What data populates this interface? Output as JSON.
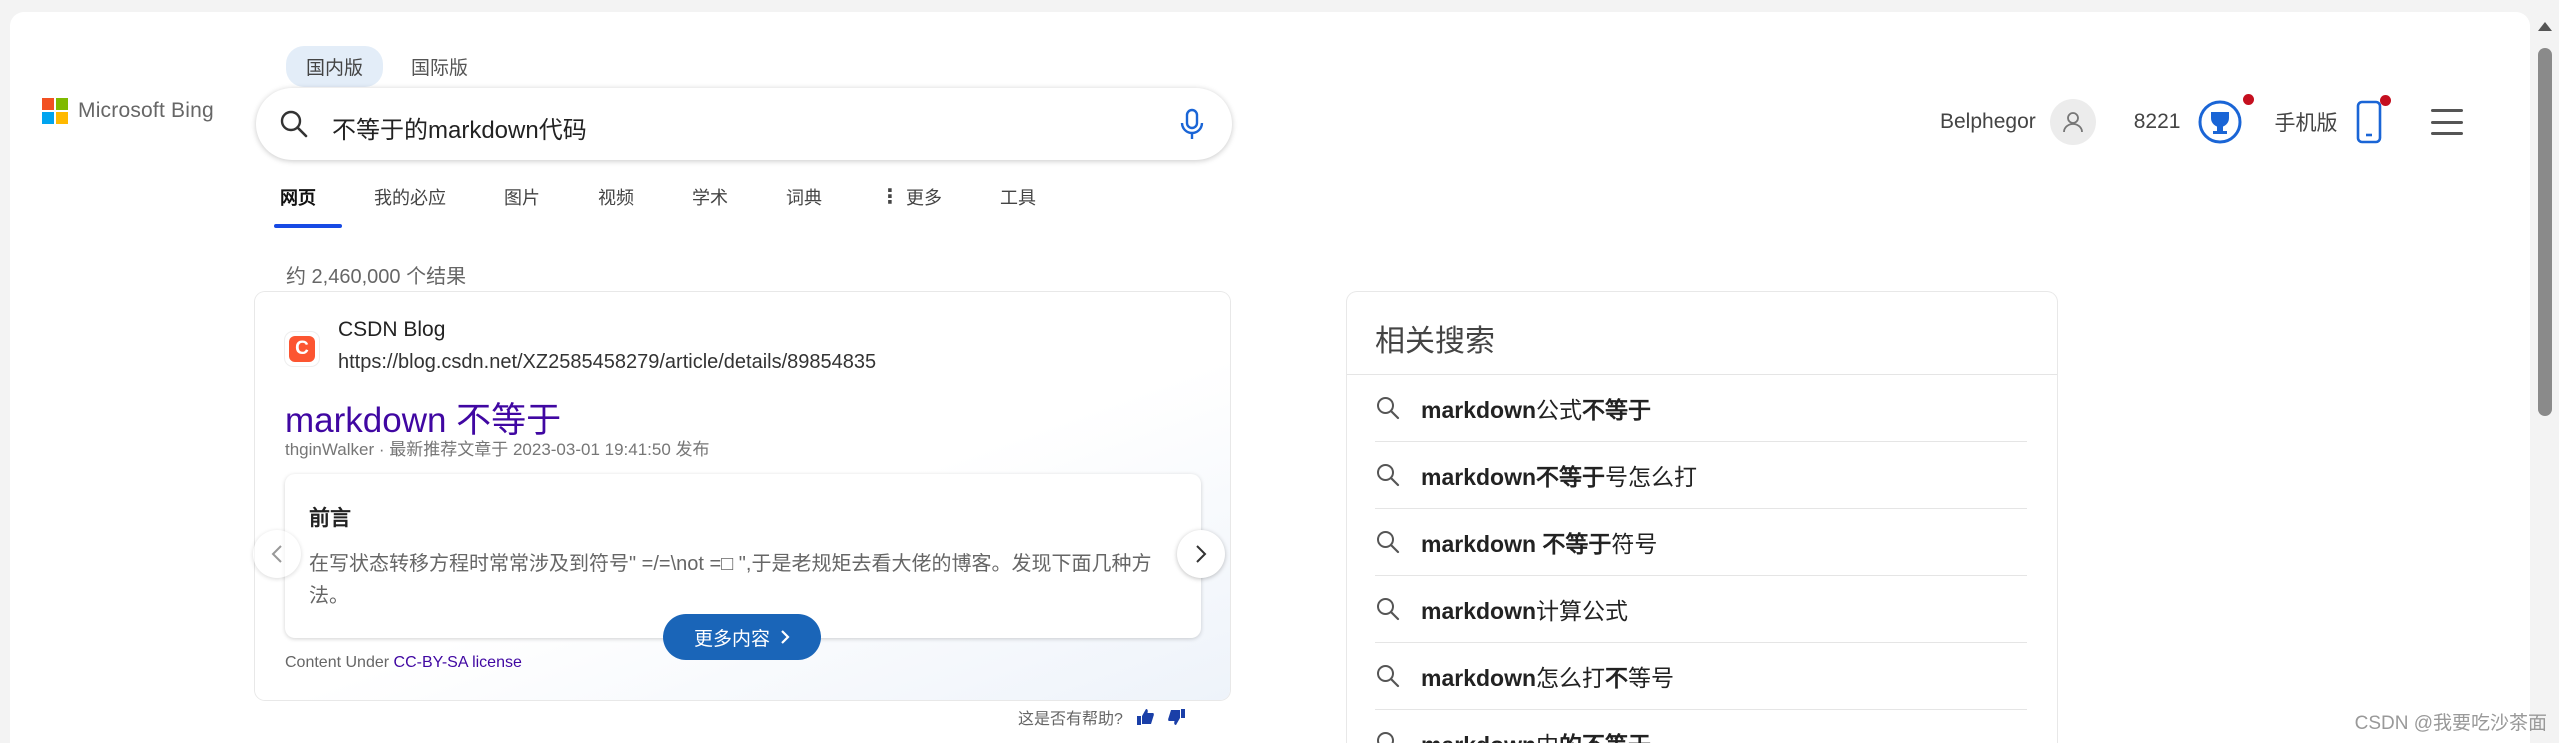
{
  "brand": {
    "logo_text": "Microsoft Bing"
  },
  "region_tabs": [
    {
      "label": "国内版",
      "active": true
    },
    {
      "label": "国际版",
      "active": false
    }
  ],
  "search": {
    "query": "不等于的markdown代码"
  },
  "nav_tabs": [
    {
      "label": "网页",
      "active": true
    },
    {
      "label": "我的必应"
    },
    {
      "label": "图片"
    },
    {
      "label": "视频"
    },
    {
      "label": "学术"
    },
    {
      "label": "词典"
    },
    {
      "label": "更多"
    },
    {
      "label": "工具"
    }
  ],
  "user": {
    "name": "Belphegor",
    "points": "8221",
    "mobile_label": "手机版"
  },
  "result_count": "约 2,460,000 个结果",
  "result": {
    "site_icon_letter": "C",
    "site_name": "CSDN Blog",
    "url": "https://blog.csdn.net/XZ2585458279/article/details/89854835",
    "title": "markdown 不等于",
    "meta": "thginWalker · 最新推荐文章于 2023-03-01 19:41:50 发布",
    "card_heading": "前言",
    "card_body": "在写状态转移方程时常常涉及到符号\" =/=\\not =□ \",于是老规矩去看大佬的博客。发现下面几种方法。",
    "more_button": "更多内容",
    "license_prefix": "Content Under ",
    "license_link": "CC-BY-SA license"
  },
  "feedback": {
    "label": "这是否有帮助?"
  },
  "related": {
    "title": "相关搜索",
    "items": [
      [
        {
          "t": "markdown",
          "b": true
        },
        {
          "t": "公式",
          "b": false
        },
        {
          "t": "不等于",
          "b": true
        }
      ],
      [
        {
          "t": "markdown不等于",
          "b": true
        },
        {
          "t": "号怎么打",
          "b": false
        }
      ],
      [
        {
          "t": "markdown 不等于",
          "b": true
        },
        {
          "t": "符号",
          "b": false
        }
      ],
      [
        {
          "t": "markdown",
          "b": true
        },
        {
          "t": "计算公式",
          "b": false
        }
      ],
      [
        {
          "t": "markdown",
          "b": true
        },
        {
          "t": "怎么打",
          "b": false
        },
        {
          "t": "不",
          "b": true
        },
        {
          "t": "等号",
          "b": false
        }
      ],
      [
        {
          "t": "markdown",
          "b": true
        },
        {
          "t": "中",
          "b": false
        },
        {
          "t": "的不等于",
          "b": true
        }
      ]
    ]
  },
  "watermark": "CSDN @我要吃沙茶面",
  "colors": {
    "accent": "#174ae4",
    "link_visited": "#4007a2",
    "more_button": "#1a65b8",
    "csdn": "#fc5531"
  }
}
